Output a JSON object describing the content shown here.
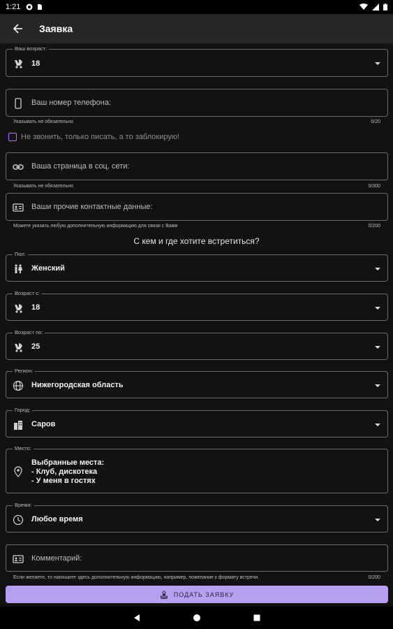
{
  "status": {
    "time": "1:21"
  },
  "appbar": {
    "title": "Заявка"
  },
  "age": {
    "label": "Ваш возраст:",
    "value": "18"
  },
  "phone": {
    "placeholder": "Ваш номер телефона:",
    "helper": "Указывать не обязательно",
    "counter": "0/20"
  },
  "no_call": {
    "label": "Не звонить, только писать, а то заблокирую!"
  },
  "social": {
    "placeholder": "Ваша страница в соц. сети:",
    "helper": "Указывать не обязательно",
    "counter": "0/300"
  },
  "other_contacts": {
    "placeholder": "Ваши прочие контактные данные:",
    "helper": "Можете указать любую дополнительную информацию для связи с Вами",
    "counter": "0/200"
  },
  "section_title": "С кем и где хотите встретиться?",
  "gender": {
    "label": "Пол:",
    "value": "Женский"
  },
  "age_from": {
    "label": "Возраст с:",
    "value": "18"
  },
  "age_to": {
    "label": "Возраст по:",
    "value": "25"
  },
  "region": {
    "label": "Регион:",
    "value": "Нижегородская область"
  },
  "city": {
    "label": "Город:",
    "value": "Саров"
  },
  "place": {
    "label": "Место:",
    "lines": [
      "Выбранные места:",
      "- Клуб, дискотека",
      "- У меня в гостях"
    ]
  },
  "time": {
    "label": "Время:",
    "value": "Любое время"
  },
  "comment": {
    "placeholder": "Комментарий:",
    "helper": "Если желаете, то напишите здесь дополнительную информацию, например, пожелание к формату встречи.",
    "counter": "0/200"
  },
  "submit": {
    "label": "ПОДАТЬ ЗАЯВКУ"
  },
  "colors": {
    "accent": "#b79ef0",
    "background": "#121212",
    "appbar": "#262626",
    "checkbox": "#a87ce8"
  }
}
